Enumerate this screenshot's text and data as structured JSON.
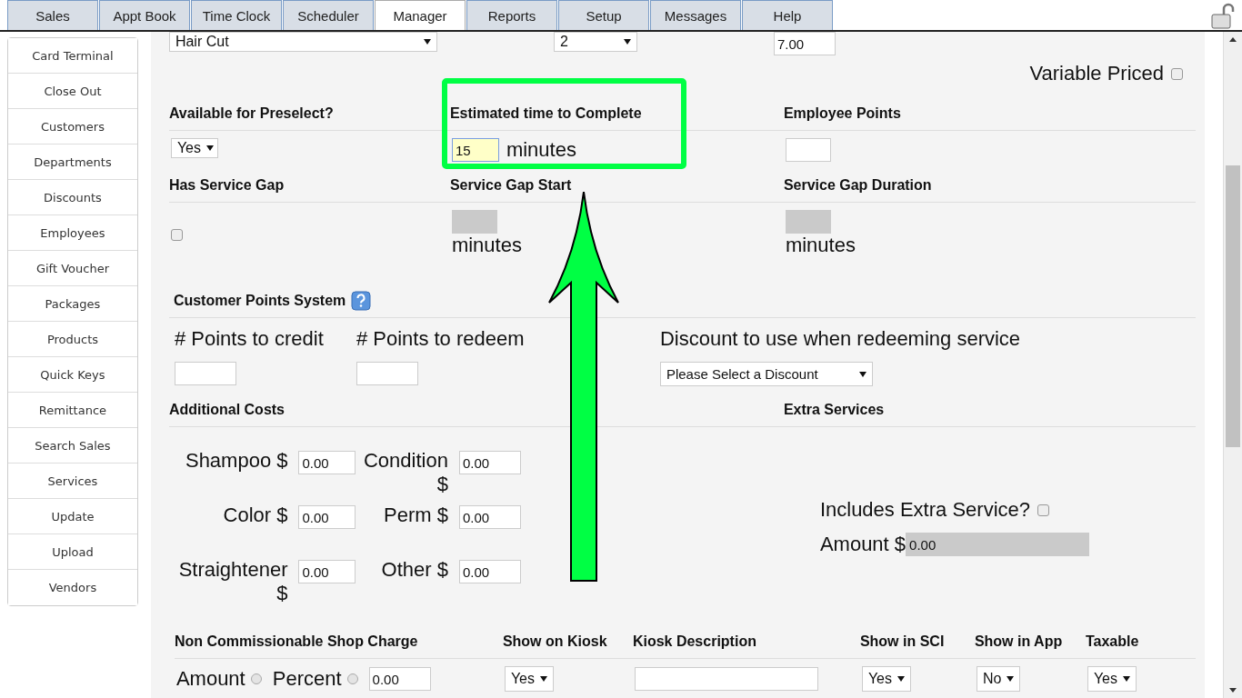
{
  "tabs": [
    {
      "label": "Sales",
      "selected": false
    },
    {
      "label": "Appt Book",
      "selected": false
    },
    {
      "label": "Time Clock",
      "selected": false
    },
    {
      "label": "Scheduler",
      "selected": false
    },
    {
      "label": "Manager",
      "selected": true
    },
    {
      "label": "Reports",
      "selected": false
    },
    {
      "label": "Setup",
      "selected": false
    },
    {
      "label": "Messages",
      "selected": false
    },
    {
      "label": "Help",
      "selected": false
    }
  ],
  "sidebar": {
    "items": [
      "Card Terminal",
      "Close Out",
      "Customers",
      "Departments",
      "Discounts",
      "Employees",
      "Gift Voucher",
      "Packages",
      "Products",
      "Quick Keys",
      "Remittance",
      "Search Sales",
      "Services",
      "Update",
      "Upload",
      "Vendors"
    ]
  },
  "top_row": {
    "service": "Hair Cut",
    "quantity": "2",
    "price": "7.00",
    "variable_priced": {
      "label": "Variable Priced",
      "checked": false
    }
  },
  "preselect": {
    "heading": "Available for Preselect?",
    "value": "Yes"
  },
  "estimated_time": {
    "heading": "Estimated time to Complete",
    "value": "15",
    "unit": "minutes"
  },
  "employee_points": {
    "heading": "Employee Points"
  },
  "service_gap": {
    "heading": "Has Service Gap",
    "checked": false
  },
  "gap_start": {
    "heading": "Service Gap Start",
    "unit": "minutes"
  },
  "gap_duration": {
    "heading": "Service Gap Duration",
    "unit": "minutes"
  },
  "customer_points": {
    "heading": "Customer Points System",
    "credit_label": "# Points to credit",
    "redeem_label": "# Points to redeem",
    "discount_label": "Discount to use when redeeming service",
    "discount_select": "Please Select a Discount"
  },
  "additional_costs": {
    "heading": "Additional Costs",
    "items": [
      {
        "label": "Shampoo $",
        "value": "0.00"
      },
      {
        "label": "Condition $",
        "value": "0.00"
      },
      {
        "label": "Color $",
        "value": "0.00"
      },
      {
        "label": "Perm $",
        "value": "0.00"
      },
      {
        "label": "Straightener $",
        "value": "0.00"
      },
      {
        "label": "Other $",
        "value": "0.00"
      }
    ]
  },
  "extra_services": {
    "heading": "Extra Services",
    "includes_label": "Includes Extra Service?",
    "includes_checked": false,
    "amount_label": "Amount $",
    "amount": "0.00"
  },
  "shop_charge": {
    "heading": "Non Commissionable Shop Charge",
    "options": [
      {
        "label": "Amount",
        "selected": false
      },
      {
        "label": "Percent",
        "selected": false
      }
    ],
    "value": "0.00"
  },
  "flags": [
    {
      "heading": "Show on Kiosk",
      "kind": "select",
      "value": "Yes"
    },
    {
      "heading": "Kiosk Description",
      "kind": "text"
    },
    {
      "heading": "Show in SCI",
      "kind": "select",
      "value": "Yes"
    },
    {
      "heading": "Show in App",
      "kind": "select",
      "value": "No"
    },
    {
      "heading": "Taxable",
      "kind": "select",
      "value": "Yes"
    }
  ]
}
